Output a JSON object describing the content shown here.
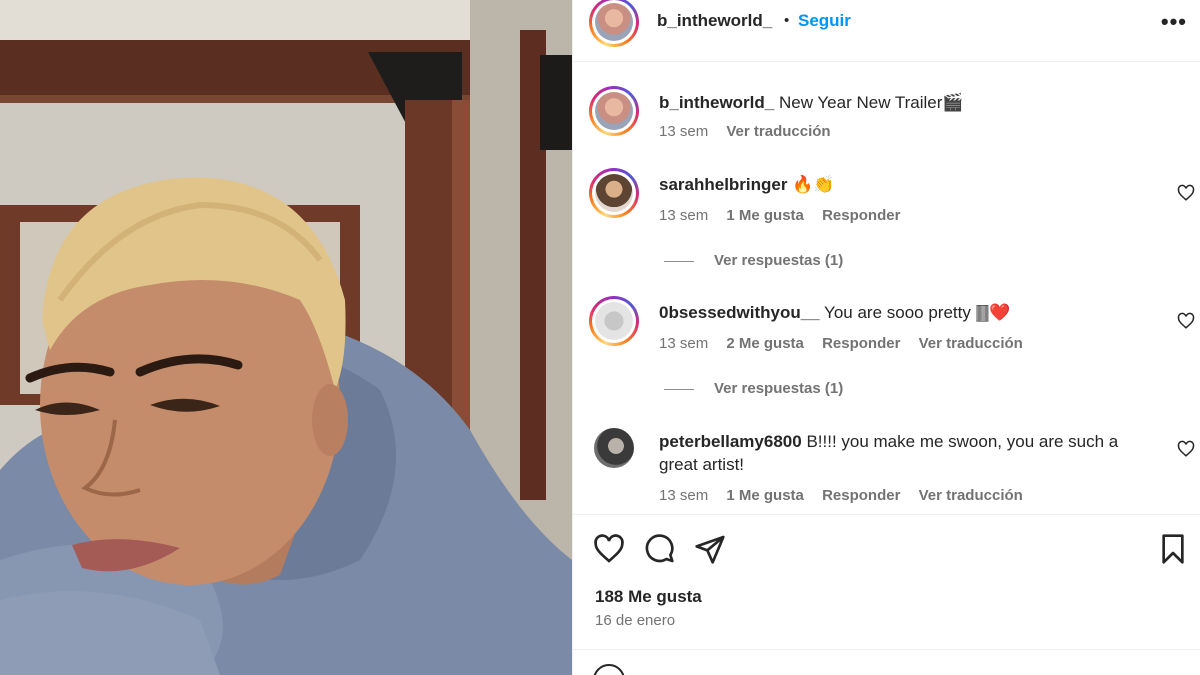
{
  "post": {
    "username": "b_intheworld_",
    "separator": "•",
    "follow_label": "Seguir",
    "more_label": "•••",
    "caption": {
      "username": "b_intheworld_",
      "text": "New Year New Trailer🎬",
      "time": "13 sem",
      "translate": "Ver traducción"
    },
    "comments": [
      {
        "username": "sarahhelbringer",
        "text": "🔥👏",
        "time": "13 sem",
        "likes": "1 Me gusta",
        "reply": "Responder",
        "replies": "Ver respuestas (1)"
      },
      {
        "username": "0bsessedwithyou__",
        "text": "You are sooo pretty 🀫❤️",
        "time": "13 sem",
        "likes": "2 Me gusta",
        "reply": "Responder",
        "translate": "Ver traducción",
        "replies": "Ver respuestas (1)"
      },
      {
        "username": "peterbellamy6800",
        "text": "B!!!! you make me swoon, you are such a great artist!",
        "time": "13 sem",
        "likes": "1 Me gusta",
        "reply": "Responder",
        "translate": "Ver traducción"
      }
    ],
    "likes_count": "188 Me gusta",
    "date": "16 de enero"
  },
  "icons": {
    "heart": "heart-icon",
    "comment": "comment-icon",
    "share": "share-icon",
    "save": "bookmark-icon",
    "emoji": "emoji-icon"
  },
  "colors": {
    "link": "#0095f6",
    "muted": "#737373",
    "text": "#262626"
  }
}
